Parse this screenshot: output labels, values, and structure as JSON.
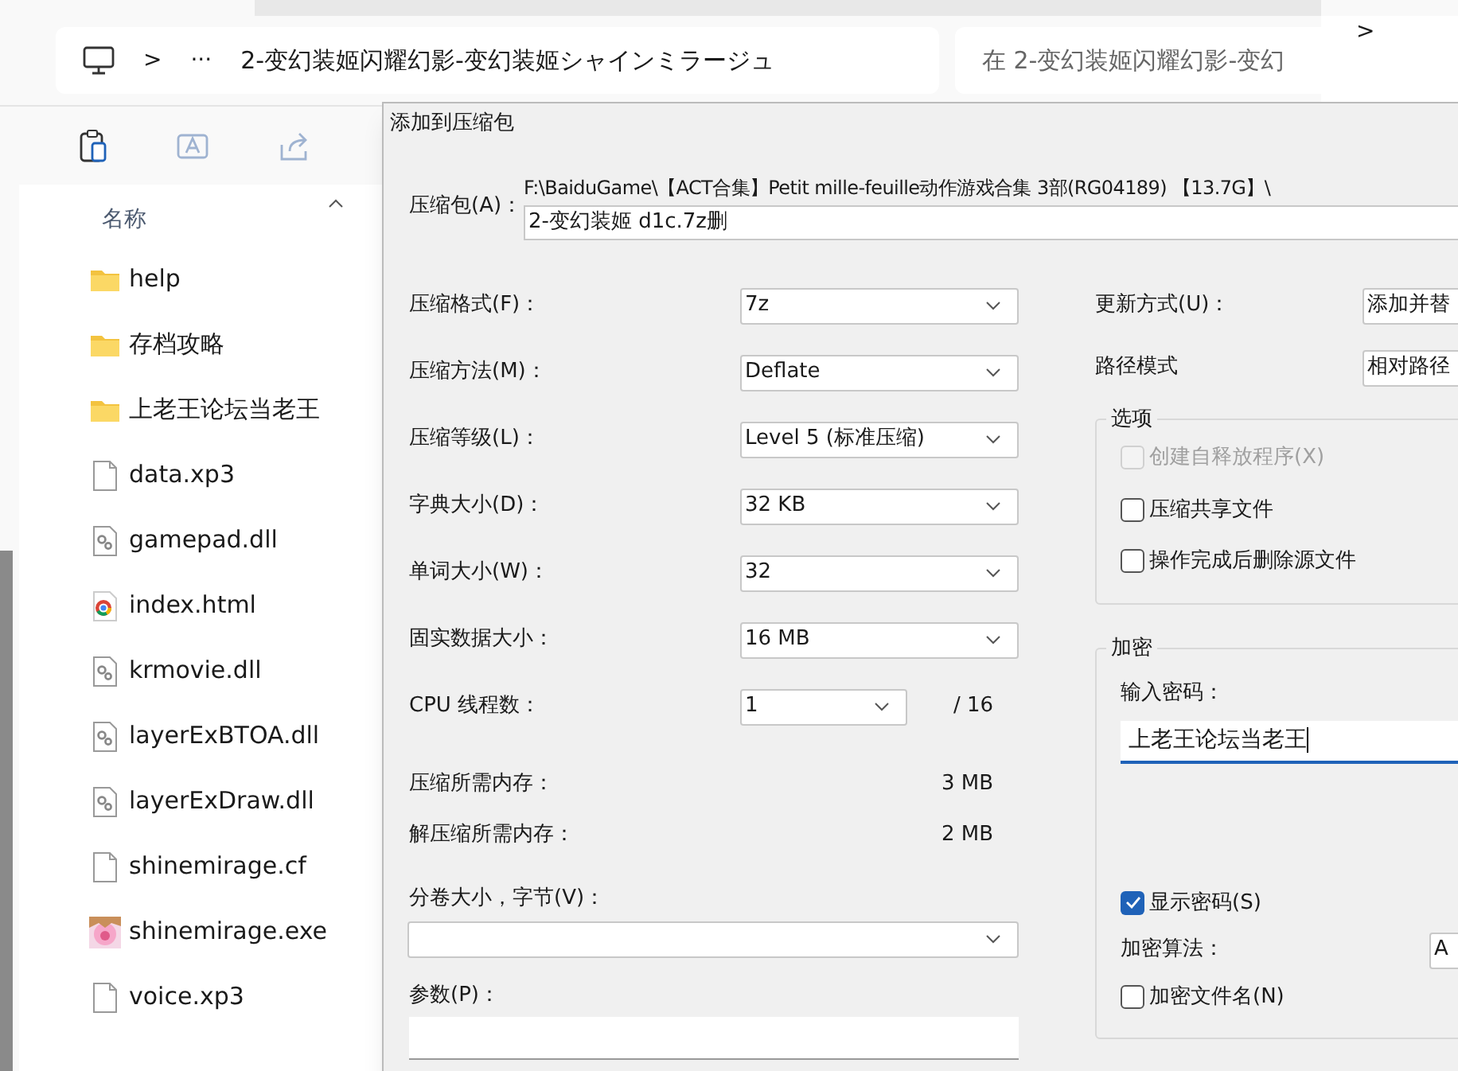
{
  "explorer": {
    "breadcrumb": {
      "separator": ">",
      "ellipsis": "···",
      "path": "2-变幻装姬闪耀幻影-变幻装姬シャインミラージュ"
    },
    "search": {
      "placeholder": "在 2-变幻装姬闪耀幻影-变幻"
    },
    "forward": ">",
    "column_header": "名称",
    "files": [
      {
        "name": "help",
        "kind": "folder"
      },
      {
        "name": "存档攻略",
        "kind": "folder"
      },
      {
        "name": "上老王论坛当老王",
        "kind": "folder"
      },
      {
        "name": "data.xp3",
        "kind": "file"
      },
      {
        "name": "gamepad.dll",
        "kind": "dll"
      },
      {
        "name": "index.html",
        "kind": "html"
      },
      {
        "name": "krmovie.dll",
        "kind": "dll"
      },
      {
        "name": "layerExBTOA.dll",
        "kind": "dll"
      },
      {
        "name": "layerExDraw.dll",
        "kind": "dll"
      },
      {
        "name": "shinemirage.cf",
        "kind": "file"
      },
      {
        "name": "shinemirage.exe",
        "kind": "exe"
      },
      {
        "name": "voice.xp3",
        "kind": "file"
      }
    ]
  },
  "dialog": {
    "title": "添加到压缩包",
    "archive": {
      "label": "压缩包(A)：",
      "folder": "F:\\BaiduGame\\【ACT合集】Petit mille-feuille动作游戏合集 3部(RG04189) 【13.7G】\\",
      "value": "2-变幻装姬 d1c.7z删"
    },
    "settings": [
      {
        "label": "压缩格式(F)：",
        "value": "7z"
      },
      {
        "label": "压缩方法(M)：",
        "value": "Deflate"
      },
      {
        "label": "压缩等级(L)：",
        "value": "Level 5 (标准压缩)"
      },
      {
        "label": "字典大小(D)：",
        "value": "32 KB"
      },
      {
        "label": "单词大小(W)：",
        "value": "32"
      },
      {
        "label": "固实数据大小：",
        "value": "16 MB"
      }
    ],
    "threads": {
      "label": "CPU 线程数：",
      "value": "1",
      "max": "/ 16"
    },
    "memory": [
      {
        "label": "压缩所需内存：",
        "value": "3 MB"
      },
      {
        "label": "解压缩所需内存：",
        "value": "2 MB"
      }
    ],
    "split": {
      "label": "分卷大小，字节(V)："
    },
    "params": {
      "label": "参数(P)："
    },
    "update": {
      "label": "更新方式(U)：",
      "value": "添加并替"
    },
    "path_mode": {
      "label": "路径模式",
      "value": "相对路径"
    },
    "options": {
      "title": "选项",
      "items": [
        {
          "label": "创建自释放程序(X)",
          "checked": false,
          "disabled": true
        },
        {
          "label": "压缩共享文件",
          "checked": false,
          "disabled": false
        },
        {
          "label": "操作完成后删除源文件",
          "checked": false,
          "disabled": false
        }
      ]
    },
    "encryption": {
      "title": "加密",
      "password_label": "输入密码：",
      "password": "上老王论坛当老王",
      "show_password": {
        "label": "显示密码(S)",
        "checked": true
      },
      "method_label": "加密算法：",
      "method_value": "A",
      "encrypt_names": {
        "label": "加密文件名(N)",
        "checked": false
      }
    }
  }
}
